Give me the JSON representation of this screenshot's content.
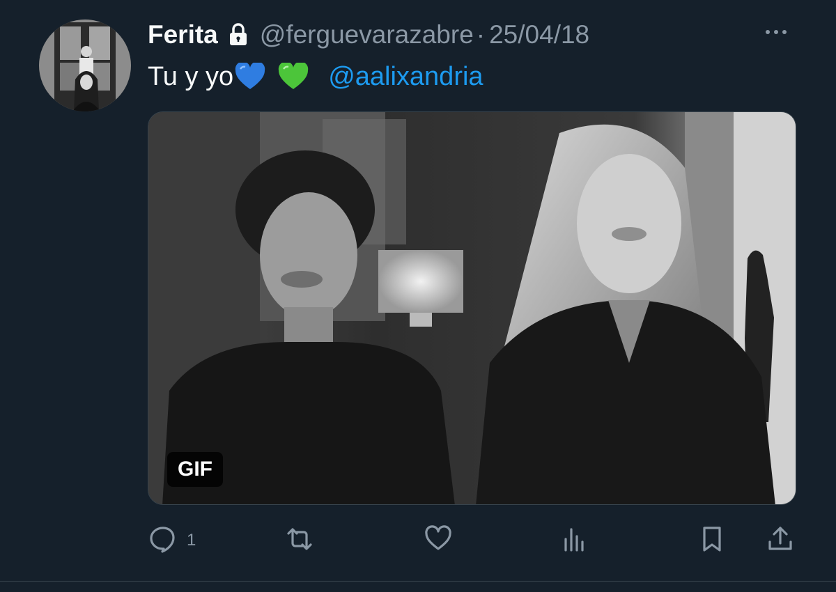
{
  "tweet": {
    "display_name": "Ferita",
    "handle": "@ferguevarazabre",
    "separator": "·",
    "date": "25/04/18",
    "text_prefix": "Tu y yo",
    "emojis": [
      "blue-heart",
      "green-heart"
    ],
    "mention": "@aalixandria",
    "protected": true
  },
  "media": {
    "type": "gif",
    "badge_label": "GIF",
    "description_icon": "black-and-white-gif-two-women-smiling"
  },
  "actions": {
    "reply": {
      "icon": "reply-icon",
      "count": "1"
    },
    "retweet": {
      "icon": "retweet-icon",
      "count": ""
    },
    "like": {
      "icon": "like-icon",
      "count": ""
    },
    "views": {
      "icon": "views-icon",
      "count": ""
    },
    "bookmark": {
      "icon": "bookmark-icon"
    },
    "share": {
      "icon": "share-icon"
    }
  },
  "colors": {
    "background": "#15202b",
    "text_primary": "#f7f9f9",
    "text_secondary": "#8b98a5",
    "accent": "#1d9bf0",
    "border": "#38444d"
  }
}
